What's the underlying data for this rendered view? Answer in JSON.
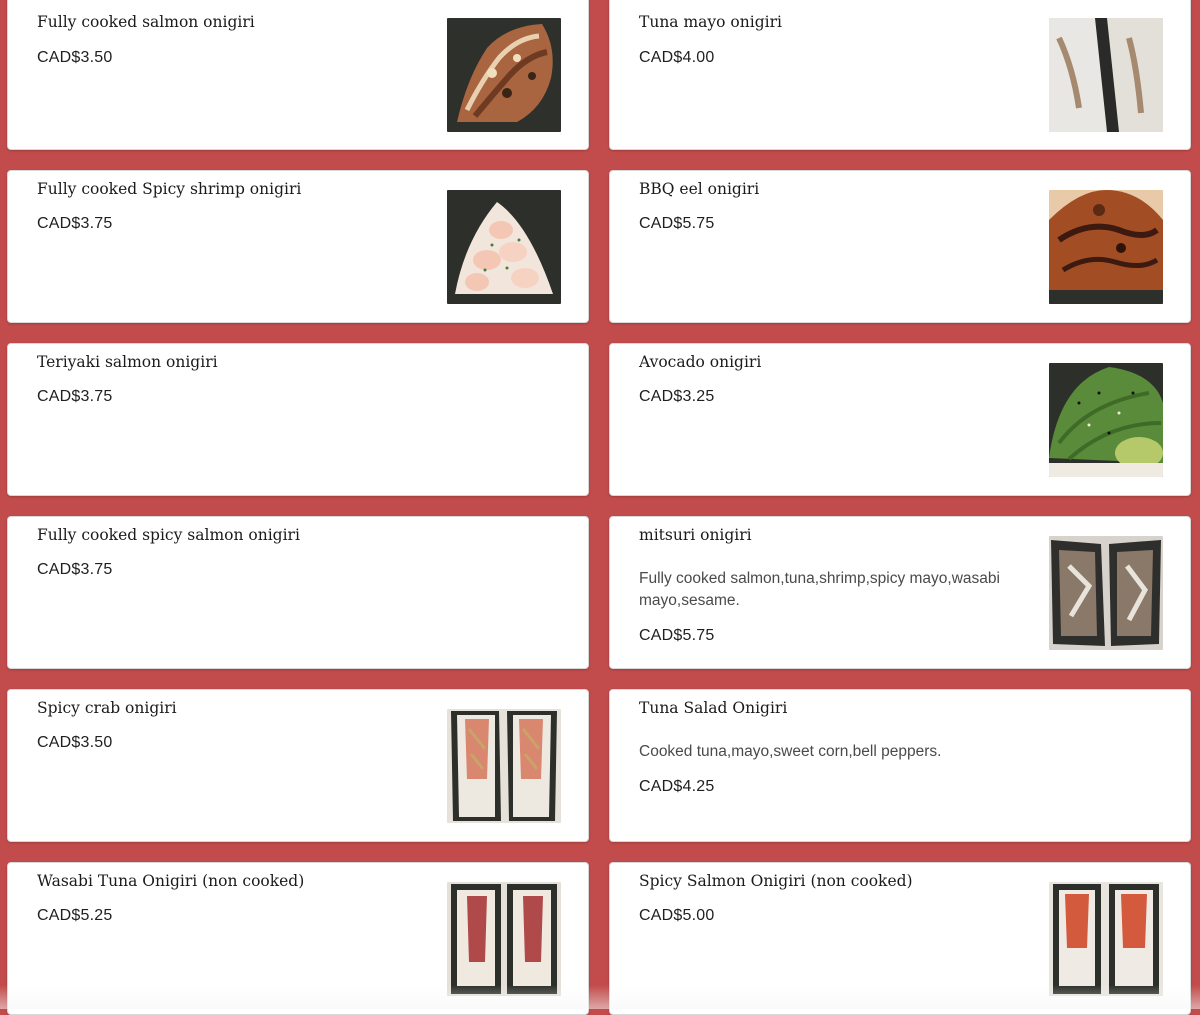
{
  "menu_items": [
    {
      "name": "Fully cooked salmon onigiri",
      "price": "CAD$3.50",
      "description": "",
      "photo": "salmon-onigiri-photo"
    },
    {
      "name": "Tuna mayo onigiri",
      "price": "CAD$4.00",
      "description": "",
      "photo": "tuna-mayo-onigiri-photo"
    },
    {
      "name": "Fully cooked Spicy shrimp onigiri",
      "price": "CAD$3.75",
      "description": "",
      "photo": "shrimp-onigiri-photo"
    },
    {
      "name": "BBQ eel onigiri",
      "price": "CAD$5.75",
      "description": "",
      "photo": "eel-onigiri-photo"
    },
    {
      "name": "Teriyaki salmon onigiri",
      "price": "CAD$3.75",
      "description": "",
      "photo": ""
    },
    {
      "name": "Avocado onigiri",
      "price": "CAD$3.25",
      "description": "",
      "photo": "avocado-onigiri-photo"
    },
    {
      "name": "Fully cooked spicy salmon onigiri",
      "price": "CAD$3.75",
      "description": "",
      "photo": ""
    },
    {
      "name": "mitsuri onigiri",
      "price": "CAD$5.75",
      "description": "Fully cooked salmon,tuna,shrimp,spicy mayo,wasabi mayo,sesame.",
      "photo": "mitsuri-onigiri-photo"
    },
    {
      "name": "Spicy crab onigiri",
      "price": "CAD$3.50",
      "description": "",
      "photo": "crab-onigiri-photo"
    },
    {
      "name": "Tuna Salad Onigiri",
      "price": "CAD$4.25",
      "description": "Cooked tuna,mayo,sweet corn,bell peppers.",
      "photo": ""
    },
    {
      "name": "Wasabi Tuna Onigiri (non cooked)",
      "price": "CAD$5.25",
      "description": "",
      "photo": "wasabi-tuna-onigiri-photo"
    },
    {
      "name": "Spicy Salmon Onigiri (non cooked)",
      "price": "CAD$5.00",
      "description": "",
      "photo": "spicy-salmon-onigiri-photo"
    }
  ],
  "colors": {
    "page_background": "#c24b4b",
    "card_background": "#ffffff",
    "seaweed": "#2c2f2a"
  }
}
